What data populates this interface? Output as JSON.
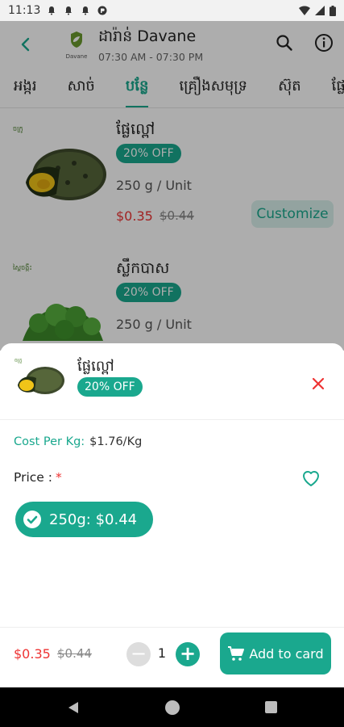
{
  "status_bar": {
    "time": "11:13"
  },
  "header": {
    "store_name": "ដារ៉ាន់ Davane",
    "hours": "07:30 AM - 07:30 PM",
    "logo_text": "Davane"
  },
  "tabs": [
    {
      "label": "អង្ករ"
    },
    {
      "label": "សាច់"
    },
    {
      "label": "បន្លែ"
    },
    {
      "label": "គ្រឿងសមុទ្រ"
    },
    {
      "label": "ស៊ុត"
    },
    {
      "label": "ផ្លែ"
    }
  ],
  "products": [
    {
      "brand": "ចក្រូ",
      "name": "ផ្លែល្ពៅ",
      "discount": "20% OFF",
      "unit": "250 g / Unit",
      "price": "$0.35",
      "old_price": "$0.44",
      "action": "Customize"
    },
    {
      "brand": "ស្ពៃចង្កឹះ",
      "name": "ស្លឹកបាស",
      "discount": "20% OFF",
      "unit": "250 g / Unit",
      "price": "",
      "old_price": "",
      "action": ""
    }
  ],
  "sheet": {
    "brand": "ចក្រូ",
    "name": "ផ្លែល្ពៅ",
    "discount": "20% OFF",
    "cost_label": "Cost Per Kg:",
    "cost_value": "$1.76/Kg",
    "price_label": "Price :",
    "required_mark": "*",
    "option": "250g: $0.44",
    "footer_price": "$0.35",
    "footer_old_price": "$0.44",
    "quantity": "1",
    "minus_symbol": "−",
    "plus_symbol": "+",
    "add_button": "Add to card"
  },
  "colors": {
    "accent": "#1aa88e",
    "price_red": "#e33333",
    "badge_bg": "#1aa88e"
  }
}
